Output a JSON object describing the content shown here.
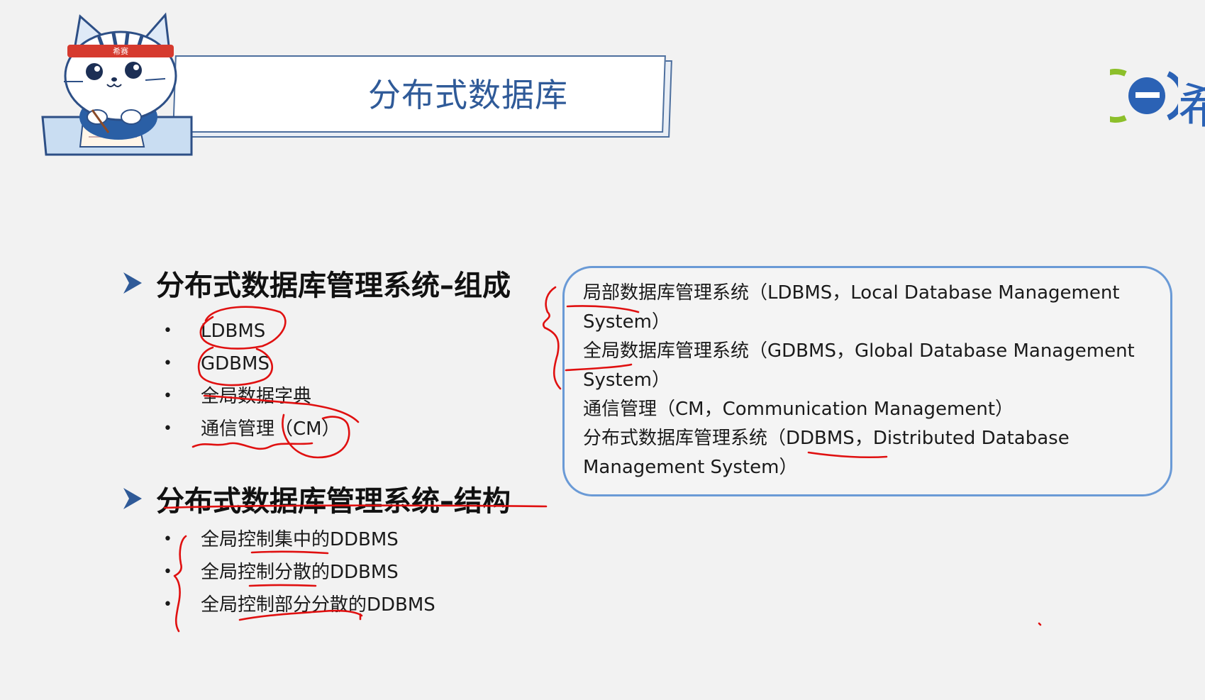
{
  "slide": {
    "title": "分布式数据库",
    "logo_glyph": "希",
    "accent_color": "#2f5a98",
    "annotation_color": "#e01010"
  },
  "mascot": {
    "headband_text": "希赛"
  },
  "section1": {
    "heading": "分布式数据库管理系统–组成",
    "items": [
      "LDBMS",
      "GDBMS",
      "全局数据字典",
      "通信管理（CM）"
    ]
  },
  "section2": {
    "heading": "分布式数据库管理系统–结构",
    "items": [
      "全局控制集中的DDBMS",
      "全局控制分散的DDBMS",
      "全局控制部分分散的DDBMS"
    ]
  },
  "info_box": {
    "lines": [
      "局部数据库管理系统（LDBMS，Local Database Management",
      "System）",
      "全局数据库管理系统（GDBMS，Global Database Management",
      "System）",
      "通信管理（CM，Communication Management）",
      "分布式数据库管理系统（DDBMS，Distributed Database",
      "Management System）"
    ]
  }
}
